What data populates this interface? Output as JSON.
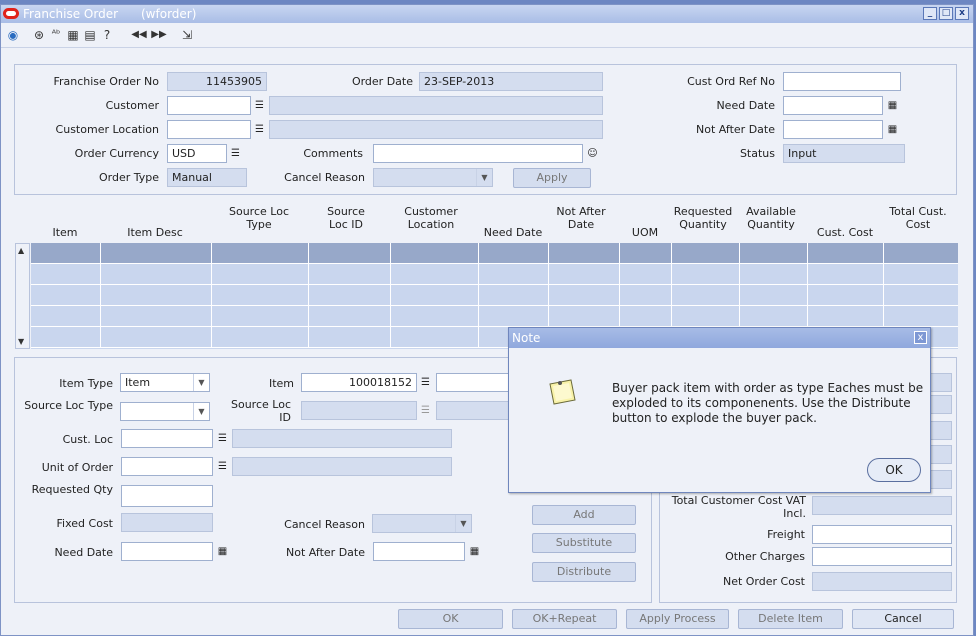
{
  "window": {
    "title": "Franchise Order",
    "subtitle": "(wforder)",
    "minimize": "_",
    "maximize": "□",
    "close": "x"
  },
  "toolbar": {
    "icons": [
      "globe-icon",
      "help-icon",
      "spellcheck-icon",
      "calendar-icon",
      "edit-icon",
      "question-icon",
      "previous-record-icon",
      "next-record-icon",
      "exit-icon"
    ]
  },
  "header": {
    "franchise_order_no_label": "Franchise Order No",
    "franchise_order_no": "11453905",
    "order_date_label": "Order Date",
    "order_date": "23-SEP-2013",
    "cust_ord_ref_no_label": "Cust Ord Ref No",
    "cust_ord_ref_no": "",
    "customer_label": "Customer",
    "customer": "",
    "need_date_label": "Need Date",
    "need_date": "",
    "customer_location_label": "Customer Location",
    "customer_location": "",
    "not_after_date_label": "Not After Date",
    "not_after_date": "",
    "order_currency_label": "Order Currency",
    "order_currency": "USD",
    "comments_label": "Comments",
    "comments": "",
    "status_label": "Status",
    "status": "Input",
    "order_type_label": "Order Type",
    "order_type": "Manual",
    "cancel_reason_label": "Cancel Reason",
    "cancel_reason": "",
    "apply_label": "Apply"
  },
  "table": {
    "columns": [
      "Item",
      "Item Desc",
      "Source Loc Type",
      "Source Loc ID",
      "Customer Location",
      "Need Date",
      "Not After Date",
      "UOM",
      "Requested Quantity",
      "Available Quantity",
      "Cust. Cost",
      "Total Cust. Cost"
    ],
    "scroll_up": "▲",
    "scroll_down": "▼"
  },
  "detail": {
    "item_type_label": "Item Type",
    "item_type": "Item",
    "item_label": "Item",
    "item": "100018152",
    "source_loc_type_label": "Source Loc Type",
    "source_loc_type": "",
    "source_loc_id_label": "Source Loc ID",
    "cust_loc_label": "Cust. Loc",
    "unit_of_order_label": "Unit of Order",
    "requested_qty_label": "Requested Qty",
    "fixed_cost_label": "Fixed Cost",
    "cancel_reason_label": "Cancel Reason",
    "need_date_label": "Need Date",
    "not_after_date_label": "Not After Date",
    "add_label": "Add",
    "substitute_label": "Substitute",
    "distribute_label": "Distribute"
  },
  "totals": {
    "total_customer_cost_vat_label": "Total Customer Cost VAT Incl.",
    "freight_label": "Freight",
    "other_charges_label": "Other Charges",
    "net_order_cost_label": "Net Order Cost"
  },
  "footer": {
    "ok": "OK",
    "ok_repeat": "OK+Repeat",
    "apply_process": "Apply Process",
    "delete_item": "Delete Item",
    "cancel": "Cancel"
  },
  "dialog": {
    "title": "Note",
    "close": "x",
    "message": "Buyer pack item with order as type Eaches must be exploded to its componenents. Use the Distribute button to explode the buyer pack.",
    "ok": "OK",
    "icon": "note-icon"
  },
  "colors": {
    "title_bar": "#a9bde6",
    "grid_selected": "#97a8c9",
    "grid_row": "#c9d6ee",
    "readonly_field": "#d4ddef"
  }
}
